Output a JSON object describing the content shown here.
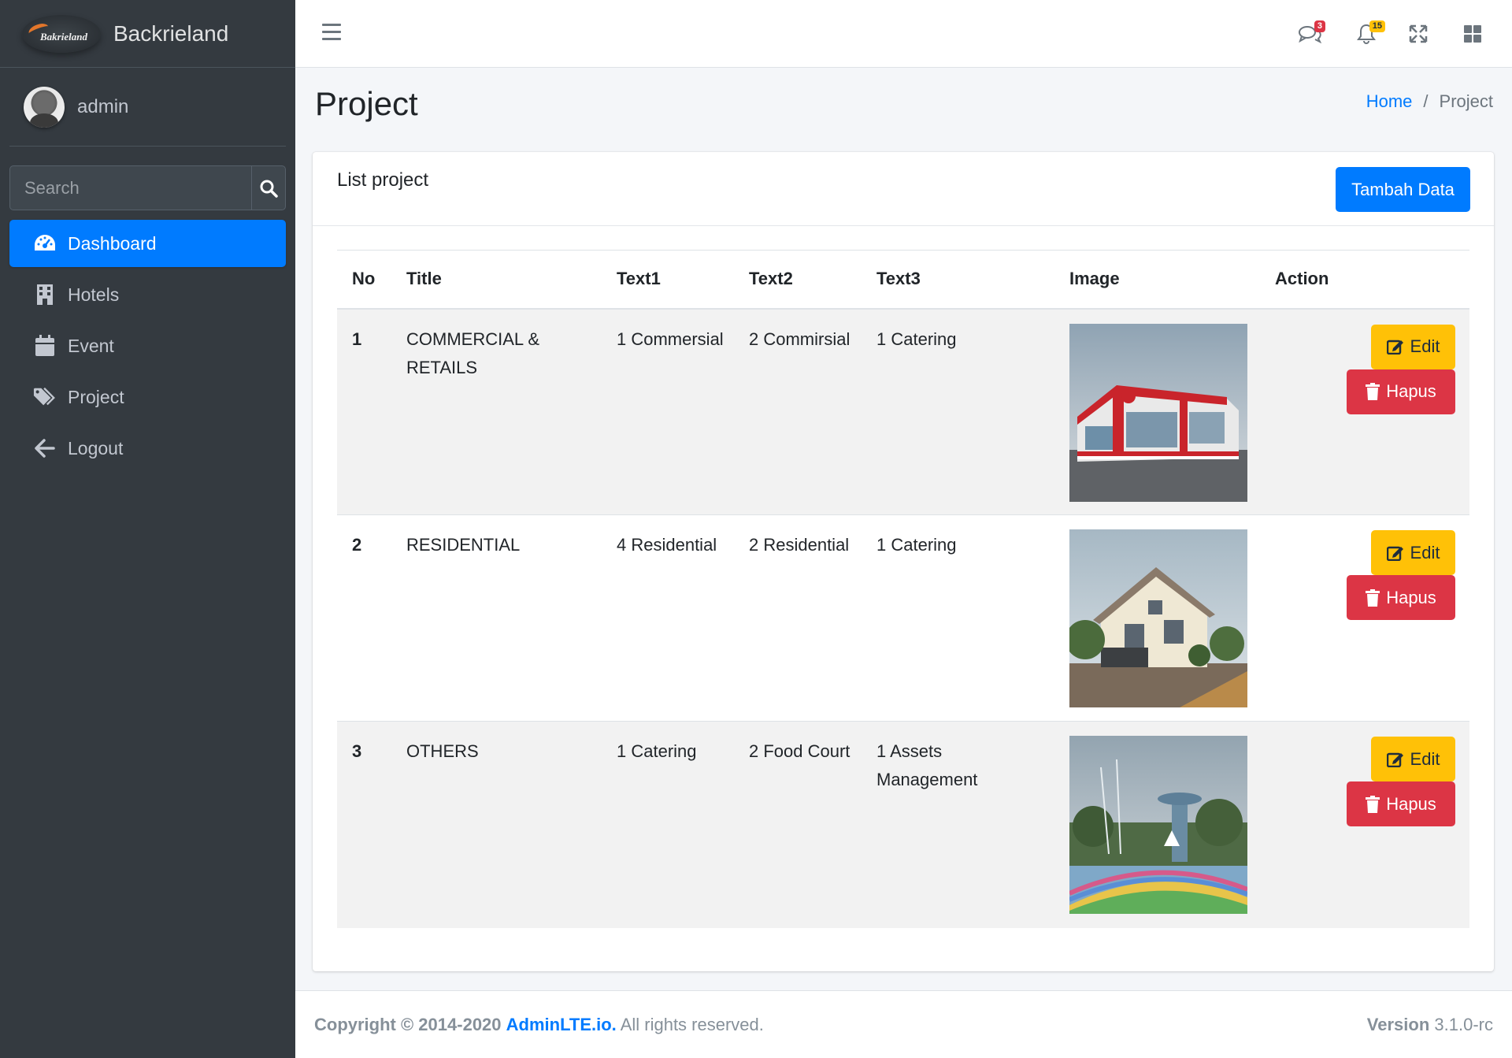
{
  "brand": {
    "name": "Backrieland",
    "logo_text": "Bakrieland"
  },
  "user": {
    "name": "admin"
  },
  "search": {
    "placeholder": "Search"
  },
  "sidebar": {
    "items": [
      {
        "label": "Dashboard",
        "icon": "tachometer-icon",
        "active": true
      },
      {
        "label": "Hotels",
        "icon": "building-icon",
        "active": false
      },
      {
        "label": "Event",
        "icon": "calendar-icon",
        "active": false
      },
      {
        "label": "Project",
        "icon": "tags-icon",
        "active": false
      },
      {
        "label": "Logout",
        "icon": "arrow-left-icon",
        "active": false
      }
    ]
  },
  "navbar": {
    "messages_badge": "3",
    "notifications_badge": "15"
  },
  "header": {
    "title": "Project",
    "breadcrumb": {
      "home": "Home",
      "current": "Project",
      "separator": "/"
    }
  },
  "card": {
    "title": "List project",
    "add_button": "Tambah Data"
  },
  "table": {
    "columns": [
      "No",
      "Title",
      "Text1",
      "Text2",
      "Text3",
      "Image",
      "Action"
    ],
    "rows": [
      {
        "no": "1",
        "title": "COMMERCIAL & RETAILS",
        "text1": "1 Commersial",
        "text2": "2 Commirsial",
        "text3": "1 Catering",
        "image": "commercial-building-photo"
      },
      {
        "no": "2",
        "title": "RESIDENTIAL",
        "text1": "4 Residential",
        "text2": "2 Residential",
        "text3": "1 Catering",
        "image": "residential-house-photo"
      },
      {
        "no": "3",
        "title": "OTHERS",
        "text1": "1 Catering",
        "text2": "2 Food Court",
        "text3": "1 Assets Management",
        "image": "waterpark-photo"
      }
    ],
    "edit_label": "Edit",
    "delete_label": "Hapus"
  },
  "footer": {
    "copyright": "Copyright © 2014-2020",
    "link": "AdminLTE.io.",
    "rights": "All rights reserved.",
    "version_label": "Version",
    "version": "3.1.0-rc"
  },
  "colors": {
    "sidebar_bg": "#343a40",
    "primary": "#007bff",
    "warning": "#ffc107",
    "danger": "#dc3545"
  }
}
